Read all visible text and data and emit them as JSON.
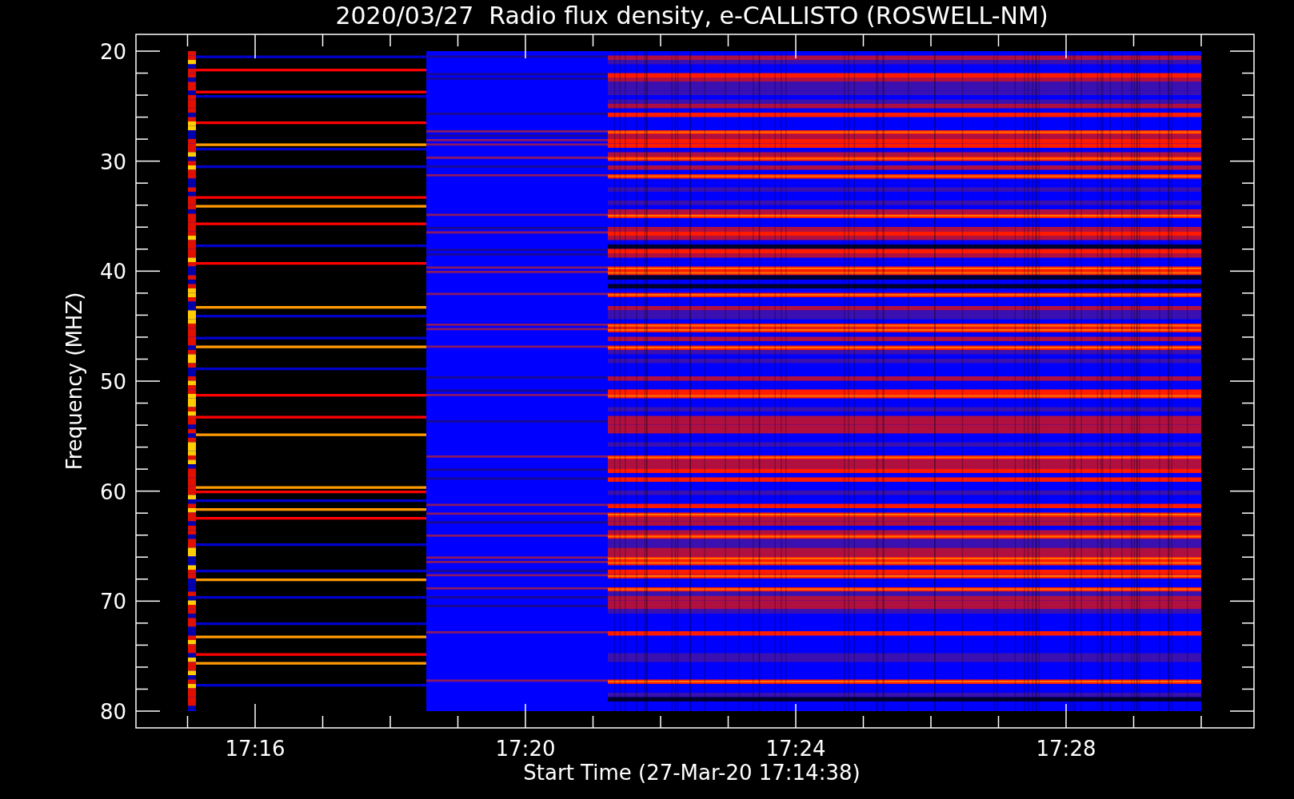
{
  "title": "2020/03/27  Radio flux density, e-CALLISTO (ROSWELL-NM)",
  "y_axis": {
    "label": "Frequency (MHZ)",
    "ticks": [
      "20",
      "30",
      "40",
      "50",
      "60",
      "70",
      "80"
    ]
  },
  "x_axis": {
    "label": "Start Time (27-Mar-20 17:14:38)",
    "ticks": [
      "17:16",
      "17:20",
      "17:24",
      "17:28"
    ]
  }
}
